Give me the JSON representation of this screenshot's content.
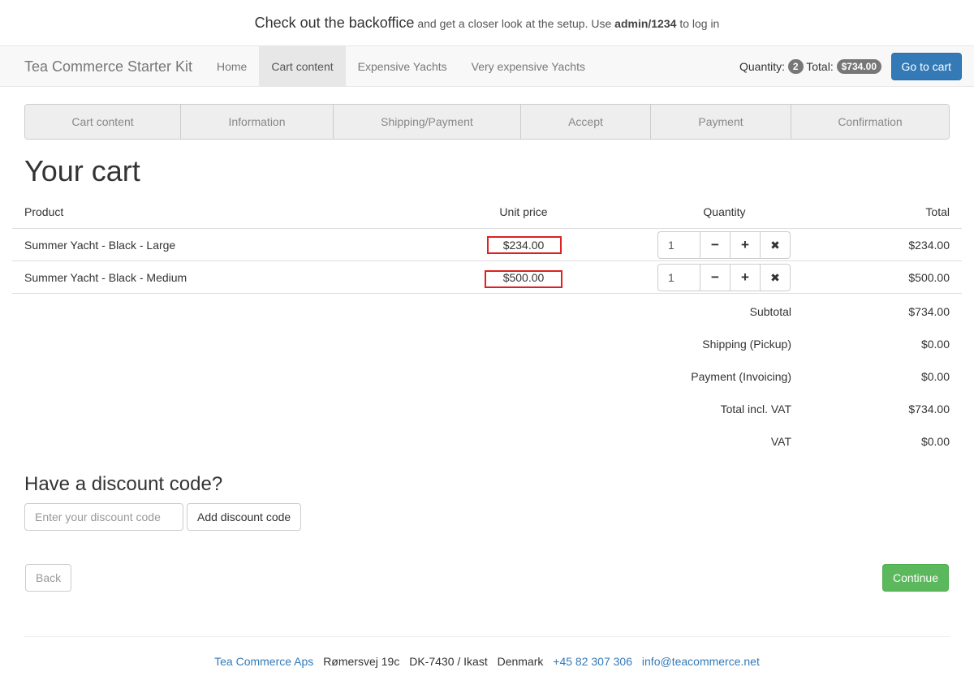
{
  "banner": {
    "lead": "Check out the backoffice",
    "text1": "and get a closer look at the setup. Use",
    "credentials": "admin/1234",
    "text2": "to log in"
  },
  "navbar": {
    "brand": "Tea Commerce Starter Kit",
    "links": [
      "Home",
      "Cart content",
      "Expensive Yachts",
      "Very expensive Yachts"
    ],
    "active": "Cart content",
    "quantity_label": "Quantity:",
    "quantity": "2",
    "total_label": "Total:",
    "total": "$734.00",
    "cart_button": "Go to cart"
  },
  "steps": [
    "Cart content",
    "Information",
    "Shipping/Payment",
    "Accept",
    "Payment",
    "Confirmation"
  ],
  "page_title": "Your cart",
  "table": {
    "headers": {
      "product": "Product",
      "unit_price": "Unit price",
      "quantity": "Quantity",
      "total": "Total"
    },
    "rows": [
      {
        "product": "Summer Yacht - Black - Large",
        "unit_price": "$234.00",
        "quantity": "1",
        "total": "$234.00"
      },
      {
        "product": "Summer Yacht - Black - Medium",
        "unit_price": "$500.00",
        "quantity": "1",
        "total": "$500.00"
      }
    ],
    "minus_icon": "−",
    "plus_icon": "+",
    "remove_icon": "✖"
  },
  "summary": [
    {
      "label": "Subtotal",
      "value": "$734.00"
    },
    {
      "label": "Shipping (Pickup)",
      "value": "$0.00"
    },
    {
      "label": "Payment (Invoicing)",
      "value": "$0.00"
    },
    {
      "label": "Total incl. VAT",
      "value": "$734.00"
    },
    {
      "label": "VAT",
      "value": "$0.00"
    }
  ],
  "discount": {
    "title": "Have a discount code?",
    "placeholder": "Enter your discount code",
    "button": "Add discount code"
  },
  "actions": {
    "back": "Back",
    "continue": "Continue"
  },
  "footer": {
    "company": "Tea Commerce Aps",
    "street": "Rømersvej 19c",
    "city": "DK-7430 / Ikast",
    "country": "Denmark",
    "phone": "+45 82 307 306",
    "email": "info@teacommerce.net"
  },
  "colors": {
    "primary": "#337ab7",
    "success": "#5cb85c",
    "highlight": "#e02020"
  }
}
